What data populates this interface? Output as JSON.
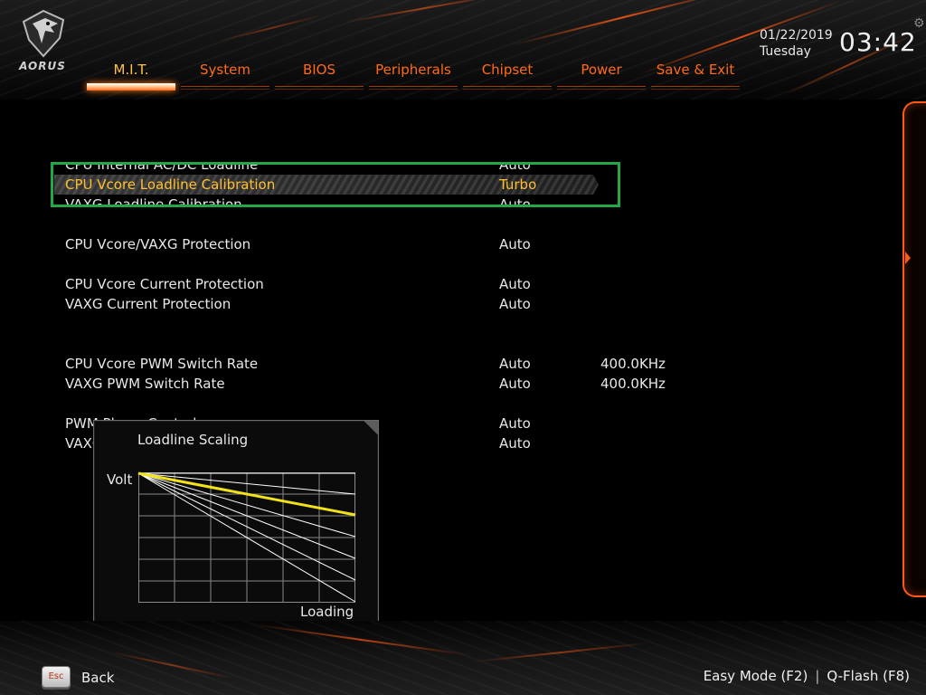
{
  "brand": {
    "name": "AORUS",
    "logo_icon": "eagle-icon"
  },
  "tabs": [
    {
      "label": "M.I.T.",
      "active": true
    },
    {
      "label": "System",
      "active": false
    },
    {
      "label": "BIOS",
      "active": false
    },
    {
      "label": "Peripherals",
      "active": false
    },
    {
      "label": "Chipset",
      "active": false
    },
    {
      "label": "Power",
      "active": false
    },
    {
      "label": "Save & Exit",
      "active": false
    }
  ],
  "clock": {
    "date": "01/22/2019",
    "weekday": "Tuesday",
    "time": "03:42",
    "settings_icon": "gear-icon"
  },
  "settings": [
    {
      "name": "CPU Internal AC/DC Loadline",
      "value": "Auto",
      "extra": ""
    },
    {
      "name": "CPU Vcore Loadline Calibration",
      "value": "Turbo",
      "extra": "",
      "selected": true
    },
    {
      "name": "VAXG Loadline Calibration",
      "value": "Auto",
      "extra": ""
    },
    {
      "name": "CPU Vcore/VAXG Protection",
      "value": "Auto",
      "extra": ""
    },
    {
      "name": "CPU Vcore Current Protection",
      "value": "Auto",
      "extra": ""
    },
    {
      "name": "VAXG Current Protection",
      "value": "Auto",
      "extra": ""
    },
    {
      "name": "CPU Vcore PWM Switch Rate",
      "value": "Auto",
      "extra": "400.0KHz"
    },
    {
      "name": "VAXG PWM Switch Rate",
      "value": "Auto",
      "extra": "400.0KHz"
    },
    {
      "name": "PWM Phase Control",
      "value": "Auto",
      "extra": ""
    },
    {
      "name": "VAXG",
      "value": "Auto",
      "extra": ""
    }
  ],
  "help_popup": {
    "title": "Loadline Scaling",
    "ylabel": "Volt",
    "xlabel": "Loading",
    "highlight_color": "#f2e21a"
  },
  "footer": {
    "esc_key": "Esc",
    "back_label": "Back",
    "easy_mode": "Easy Mode (F2)",
    "separator": "|",
    "qflash": "Q-Flash (F8)"
  },
  "colors": {
    "accent": "#ff6a1a",
    "selected_text": "#ffc030",
    "selection_box": "#22a845"
  }
}
